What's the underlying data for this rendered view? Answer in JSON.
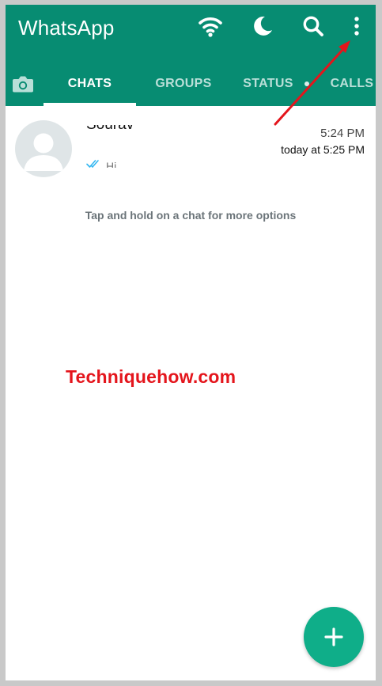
{
  "app": {
    "title": "WhatsApp"
  },
  "header_icons": [
    "wifi-icon",
    "moon-icon",
    "search-icon",
    "more-vert-icon"
  ],
  "tabs": [
    {
      "label": "CHATS",
      "active": true
    },
    {
      "label": "GROUPS",
      "active": false
    },
    {
      "label": "STATUS",
      "active": false,
      "has_dot": true
    },
    {
      "label": "CALLS",
      "active": false
    }
  ],
  "chat": {
    "name": "Sourav",
    "preview": "Hi",
    "time": "5:24 PM",
    "subtime": "today at 5:25 PM"
  },
  "hint": "Tap and hold on a chat for more options",
  "watermark": "Techniquehow.com",
  "colors": {
    "header": "#078c72",
    "fab": "#0fae89",
    "annotation_arrow": "#e4151c",
    "watermark": "#e4151c",
    "read_ticks": "#34b7f1"
  }
}
